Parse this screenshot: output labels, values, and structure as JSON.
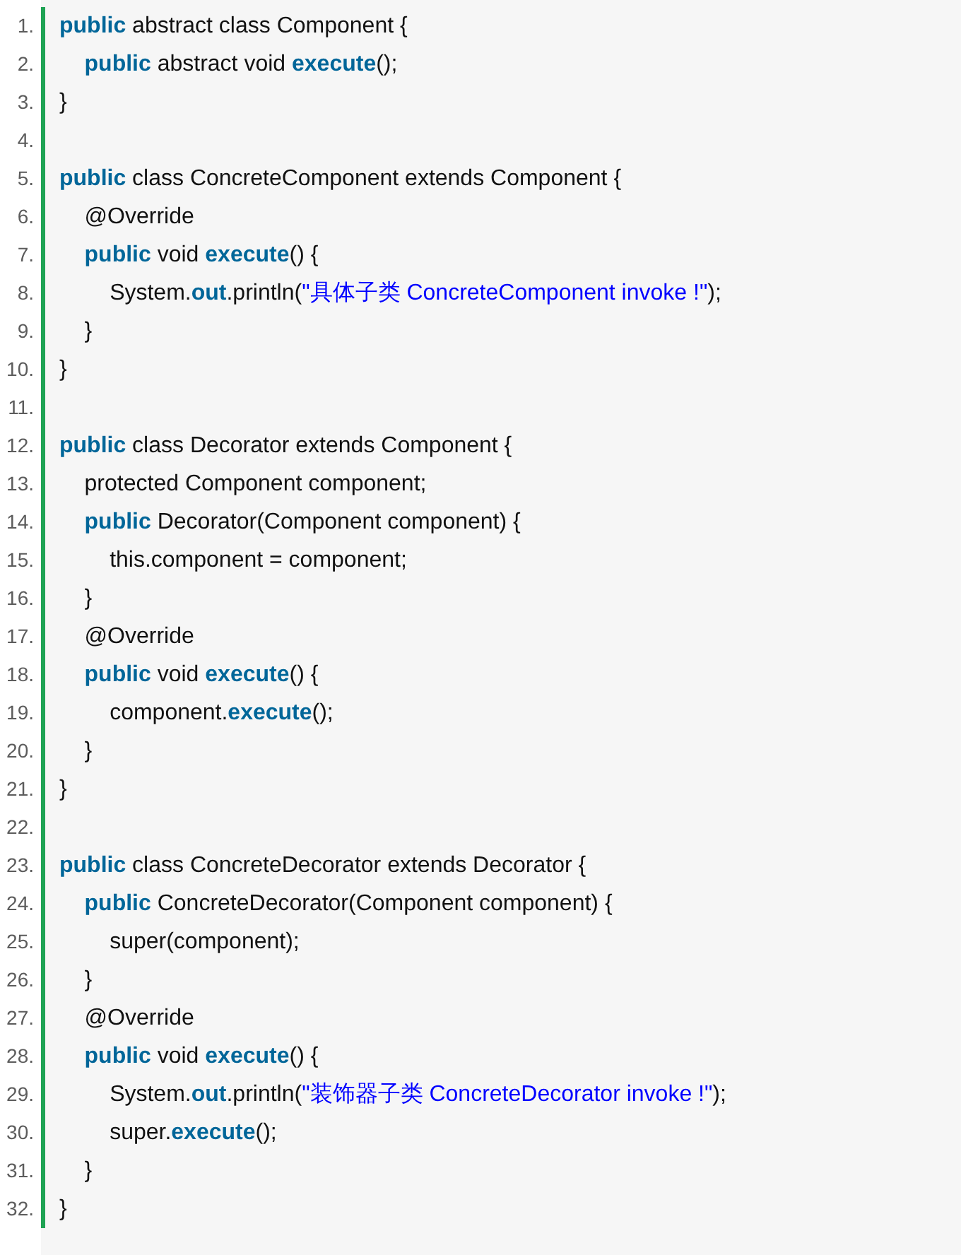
{
  "code_lines": [
    {
      "number": "1.",
      "segments": [
        {
          "kind": "keyword",
          "text": "public"
        },
        {
          "kind": "plain",
          "text": " abstract class Component {"
        }
      ]
    },
    {
      "number": "2.",
      "segments": [
        {
          "kind": "keyword",
          "text": "    public"
        },
        {
          "kind": "plain",
          "text": " abstract void "
        },
        {
          "kind": "keyword",
          "text": "execute"
        },
        {
          "kind": "plain",
          "text": "();"
        }
      ]
    },
    {
      "number": "3.",
      "segments": [
        {
          "kind": "plain",
          "text": "}"
        }
      ]
    },
    {
      "number": "4."
    },
    {
      "number": "5.",
      "segments": [
        {
          "kind": "keyword",
          "text": "public"
        },
        {
          "kind": "plain",
          "text": " class ConcreteComponent extends Component {"
        }
      ]
    },
    {
      "number": "6.",
      "segments": [
        {
          "kind": "plain",
          "text": "    @Override"
        }
      ]
    },
    {
      "number": "7.",
      "segments": [
        {
          "kind": "keyword",
          "text": "    public"
        },
        {
          "kind": "plain",
          "text": " void "
        },
        {
          "kind": "keyword",
          "text": "execute"
        },
        {
          "kind": "plain",
          "text": "() {"
        }
      ]
    },
    {
      "number": "8.",
      "segments": [
        {
          "kind": "plain",
          "text": "        System."
        },
        {
          "kind": "keyword",
          "text": "out"
        },
        {
          "kind": "plain",
          "text": ".println("
        },
        {
          "kind": "string",
          "text": "\"具体子类 ConcreteComponent invoke !\""
        },
        {
          "kind": "plain",
          "text": ");"
        }
      ]
    },
    {
      "number": "9.",
      "segments": [
        {
          "kind": "plain",
          "text": "    }"
        }
      ]
    },
    {
      "number": "10.",
      "segments": [
        {
          "kind": "plain",
          "text": "}"
        }
      ]
    },
    {
      "number": "11."
    },
    {
      "number": "12.",
      "segments": [
        {
          "kind": "keyword",
          "text": "public"
        },
        {
          "kind": "plain",
          "text": " class Decorator extends Component {"
        }
      ]
    },
    {
      "number": "13.",
      "segments": [
        {
          "kind": "plain",
          "text": "    protected Component component;"
        }
      ]
    },
    {
      "number": "14.",
      "segments": [
        {
          "kind": "keyword",
          "text": "    public"
        },
        {
          "kind": "plain",
          "text": " Decorator(Component component) {"
        }
      ]
    },
    {
      "number": "15.",
      "segments": [
        {
          "kind": "plain",
          "text": "        this.component = component;"
        }
      ]
    },
    {
      "number": "16.",
      "segments": [
        {
          "kind": "plain",
          "text": "    }"
        }
      ]
    },
    {
      "number": "17.",
      "segments": [
        {
          "kind": "plain",
          "text": "    @Override"
        }
      ]
    },
    {
      "number": "18.",
      "segments": [
        {
          "kind": "keyword",
          "text": "    public"
        },
        {
          "kind": "plain",
          "text": " void "
        },
        {
          "kind": "keyword",
          "text": "execute"
        },
        {
          "kind": "plain",
          "text": "() {"
        }
      ]
    },
    {
      "number": "19.",
      "segments": [
        {
          "kind": "plain",
          "text": "        component."
        },
        {
          "kind": "keyword",
          "text": "execute"
        },
        {
          "kind": "plain",
          "text": "();"
        }
      ]
    },
    {
      "number": "20.",
      "segments": [
        {
          "kind": "plain",
          "text": "    }"
        }
      ]
    },
    {
      "number": "21.",
      "segments": [
        {
          "kind": "plain",
          "text": "}"
        }
      ]
    },
    {
      "number": "22."
    },
    {
      "number": "23.",
      "segments": [
        {
          "kind": "keyword",
          "text": "public"
        },
        {
          "kind": "plain",
          "text": " class ConcreteDecorator extends Decorator {"
        }
      ]
    },
    {
      "number": "24.",
      "segments": [
        {
          "kind": "keyword",
          "text": "    public"
        },
        {
          "kind": "plain",
          "text": " ConcreteDecorator(Component component) {"
        }
      ]
    },
    {
      "number": "25.",
      "segments": [
        {
          "kind": "plain",
          "text": "        super(component);"
        }
      ]
    },
    {
      "number": "26.",
      "segments": [
        {
          "kind": "plain",
          "text": "    }"
        }
      ]
    },
    {
      "number": "27.",
      "segments": [
        {
          "kind": "plain",
          "text": "    @Override"
        }
      ]
    },
    {
      "number": "28.",
      "segments": [
        {
          "kind": "keyword",
          "text": "    public"
        },
        {
          "kind": "plain",
          "text": " void "
        },
        {
          "kind": "keyword",
          "text": "execute"
        },
        {
          "kind": "plain",
          "text": "() {"
        }
      ]
    },
    {
      "number": "29.",
      "segments": [
        {
          "kind": "plain",
          "text": "        System."
        },
        {
          "kind": "keyword",
          "text": "out"
        },
        {
          "kind": "plain",
          "text": ".println("
        },
        {
          "kind": "string",
          "text": "\"装饰器子类 ConcreteDecorator invoke !\""
        },
        {
          "kind": "plain",
          "text": ");"
        }
      ]
    },
    {
      "number": "30.",
      "segments": [
        {
          "kind": "plain",
          "text": "        super."
        },
        {
          "kind": "keyword",
          "text": "execute"
        },
        {
          "kind": "plain",
          "text": "();"
        }
      ]
    },
    {
      "number": "31.",
      "segments": [
        {
          "kind": "plain",
          "text": "    }"
        }
      ]
    },
    {
      "number": "32.",
      "segments": [
        {
          "kind": "plain",
          "text": "}"
        }
      ]
    }
  ]
}
